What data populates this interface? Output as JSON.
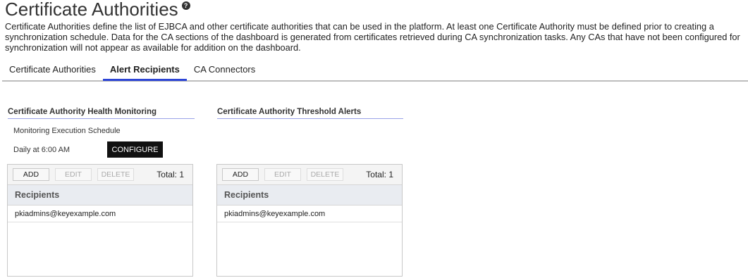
{
  "page": {
    "title": "Certificate Authorities",
    "help_icon": "question-circle-icon",
    "description": "Certificate Authorities define the list of EJBCA and other certificate authorities that can be used in the platform. At least one Certificate Authority must be defined prior to creating a synchronization schedule. Data for the CA sections of the dashboard is generated from certificates retrieved during CA synchronization tasks. Any CAs that have not been configured for synchronization will not appear as available for addition on the dashboard."
  },
  "tabs": [
    {
      "label": "Certificate Authorities",
      "active": false
    },
    {
      "label": "Alert Recipients",
      "active": true
    },
    {
      "label": "CA Connectors",
      "active": false
    }
  ],
  "health": {
    "title": "Certificate Authority Health Monitoring",
    "schedule_label": "Monitoring Execution Schedule",
    "schedule_value": "Daily at 6:00 AM",
    "configure_label": "CONFIGURE",
    "grid": {
      "add": "ADD",
      "edit": "EDIT",
      "delete": "DELETE",
      "total": "Total: 1",
      "column": "Recipients",
      "rows": [
        "pkiadmins@keyexample.com"
      ]
    }
  },
  "threshold": {
    "title": "Certificate Authority Threshold Alerts",
    "grid": {
      "add": "ADD",
      "edit": "EDIT",
      "delete": "DELETE",
      "total": "Total: 1",
      "column": "Recipients",
      "rows": [
        "pkiadmins@keyexample.com"
      ]
    }
  },
  "colors": {
    "active_tab_underline": "#2d45d6",
    "configure_bg": "#111111",
    "grid_header_bg": "#e9ecf1"
  }
}
